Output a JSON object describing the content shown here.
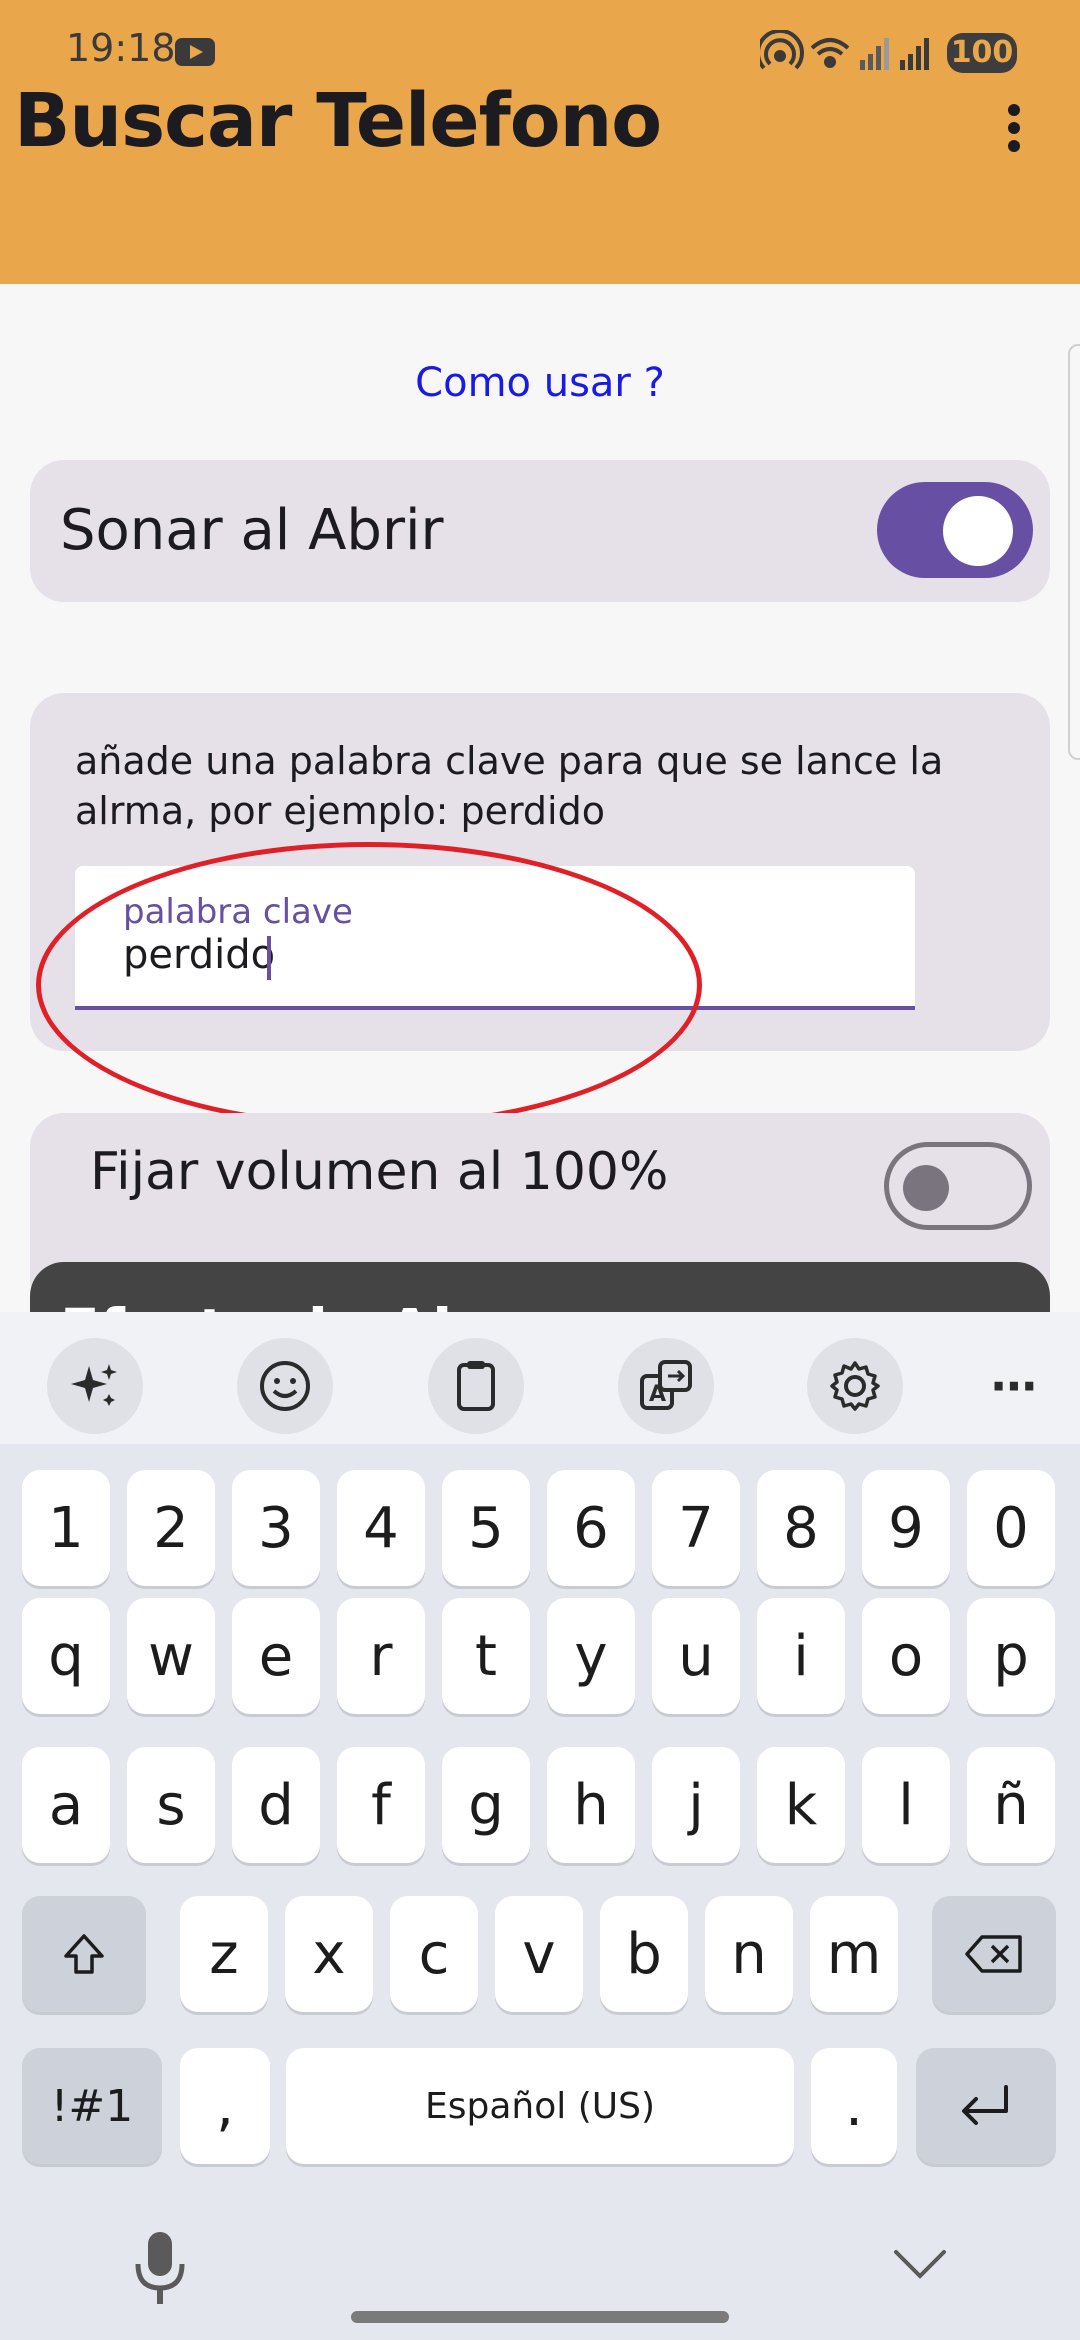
{
  "status_bar": {
    "time": "19:18",
    "battery": "100"
  },
  "app_bar": {
    "title": "Buscar Telefono"
  },
  "main": {
    "how_to_link": "Como usar ?",
    "sound_on_open": {
      "label": "Sonar al Abrir",
      "enabled": true
    },
    "keyword_card": {
      "description": "añade una palabra clave para que se lance la alrma, por ejemplo: perdido",
      "field_label": "palabra clave",
      "field_value": "perdido"
    },
    "volume": {
      "label": "Fijar volumen al 100%",
      "enabled": false
    },
    "next_card_title": "Efecto de Alarma"
  },
  "keyboard": {
    "toolbar": [
      "sparkle-icon",
      "emoji-icon",
      "clipboard-icon",
      "translate-icon",
      "settings-icon",
      "more-icon"
    ],
    "row_numbers": [
      "1",
      "2",
      "3",
      "4",
      "5",
      "6",
      "7",
      "8",
      "9",
      "0"
    ],
    "row_1": [
      "q",
      "w",
      "e",
      "r",
      "t",
      "y",
      "u",
      "i",
      "o",
      "p"
    ],
    "row_2": [
      "a",
      "s",
      "d",
      "f",
      "g",
      "h",
      "j",
      "k",
      "l",
      "ñ"
    ],
    "row_3": [
      "z",
      "x",
      "c",
      "v",
      "b",
      "n",
      "m"
    ],
    "symbols_key": "!#1",
    "comma_key": ",",
    "space_label": "Español (US)",
    "period_key": "."
  },
  "colors": {
    "app_bar": "#eaa64a",
    "accent": "#6750a4",
    "link": "#1a1ae6",
    "highlight": "#e11f27"
  }
}
